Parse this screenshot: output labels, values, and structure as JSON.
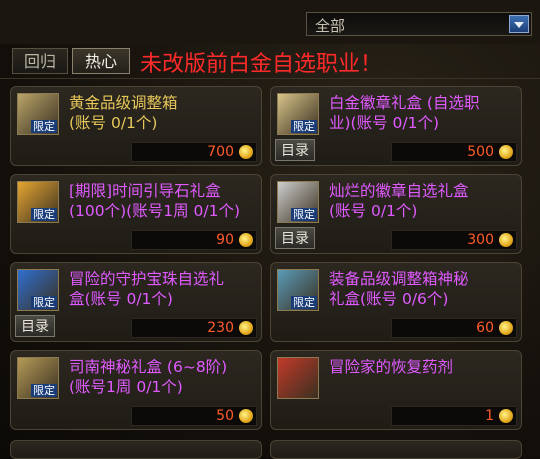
{
  "filter": {
    "selected": "全部"
  },
  "tabs": [
    {
      "label": "回归"
    },
    {
      "label": "热心"
    }
  ],
  "notice": "未改版前白金自选职业！",
  "items": [
    {
      "name": "黄金品级调整箱\n(账号 0/1个)",
      "price": "700",
      "badge": "限定",
      "catalog": "",
      "name_color": "gold",
      "icon_color": "#b9a46a"
    },
    {
      "name": "白金徽章礼盒 (自选职\n业)(账号 0/1个)",
      "price": "500",
      "badge": "限定",
      "catalog": "目录",
      "name_color": "purple",
      "icon_color": "#d8c48a"
    },
    {
      "name": "[期限]时间引导石礼盒\n(100个)(账号1周 0/1个)",
      "price": "90",
      "badge": "限定",
      "catalog": "",
      "name_color": "purple",
      "icon_color": "#e6a632"
    },
    {
      "name": "灿烂的徽章自选礼盒\n(账号 0/1个)",
      "price": "300",
      "badge": "限定",
      "catalog": "目录",
      "name_color": "purple",
      "icon_color": "#cfcfcf"
    },
    {
      "name": "冒险的守护宝珠自选礼\n盒(账号 0/1个)",
      "price": "230",
      "badge": "限定",
      "catalog": "目录",
      "name_color": "purple",
      "icon_color": "#2f6fd0"
    },
    {
      "name": "装备品级调整箱神秘\n礼盒(账号 0/6个)",
      "price": "60",
      "badge": "限定",
      "catalog": "",
      "name_color": "purple",
      "icon_color": "#5a9bb8"
    },
    {
      "name": "司南神秘礼盒 (6~8阶)\n(账号1周 0/1个)",
      "price": "50",
      "badge": "限定",
      "catalog": "",
      "name_color": "purple",
      "icon_color": "#b59a58"
    },
    {
      "name": "冒险家的恢复药剂",
      "price": "1",
      "badge": "",
      "catalog": "",
      "name_color": "purple",
      "icon_color": "#c23a2a"
    }
  ]
}
